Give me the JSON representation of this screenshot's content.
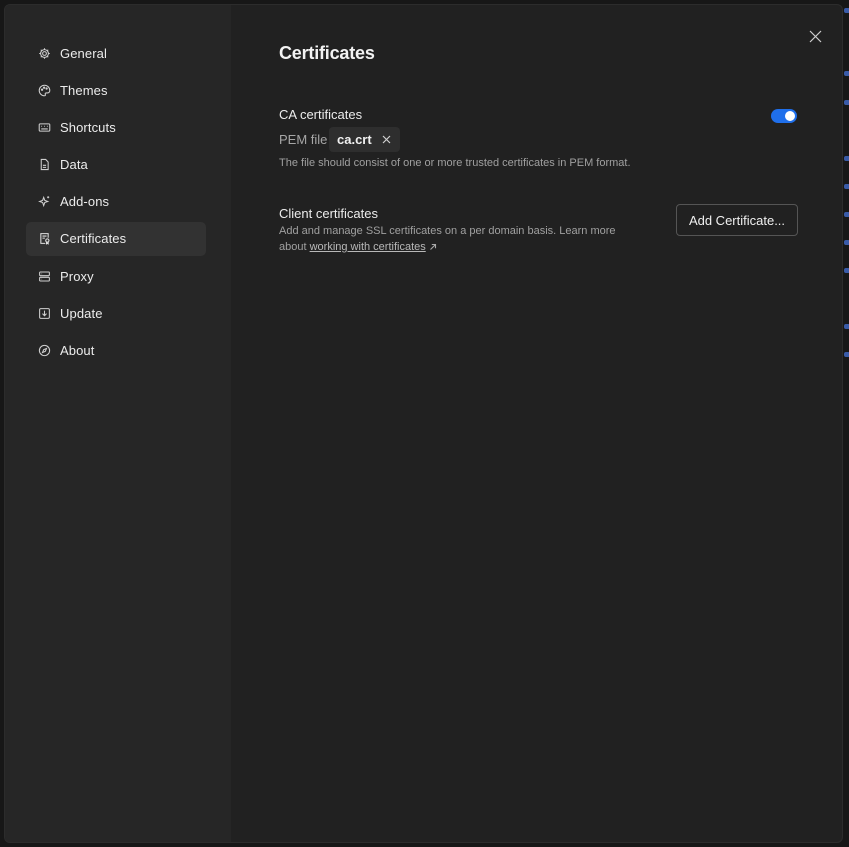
{
  "sidebar": {
    "items": [
      {
        "label": "General",
        "icon": "gear-icon"
      },
      {
        "label": "Themes",
        "icon": "palette-icon"
      },
      {
        "label": "Shortcuts",
        "icon": "keyboard-icon"
      },
      {
        "label": "Data",
        "icon": "document-icon"
      },
      {
        "label": "Add-ons",
        "icon": "sparkle-icon"
      },
      {
        "label": "Certificates",
        "icon": "certificate-icon",
        "active": true
      },
      {
        "label": "Proxy",
        "icon": "server-icon"
      },
      {
        "label": "Update",
        "icon": "download-icon"
      },
      {
        "label": "About",
        "icon": "compass-icon"
      }
    ]
  },
  "main": {
    "title": "Certificates",
    "ca": {
      "title": "CA certificates",
      "enabled": true,
      "pem_label": "PEM file",
      "file_name": "ca.crt",
      "hint": "The file should consist of one or more trusted certificates in PEM format."
    },
    "client": {
      "title": "Client certificates",
      "hint_line1": "Add and manage SSL certificates on a per domain basis. Learn more",
      "hint_prefix": "about",
      "link_text": "working with certificates",
      "add_button": "Add Certificate..."
    }
  },
  "colors": {
    "accent": "#1f6feb",
    "dialog_bg": "#212121",
    "sidebar_bg": "#262626",
    "active_item_bg": "#323232"
  }
}
